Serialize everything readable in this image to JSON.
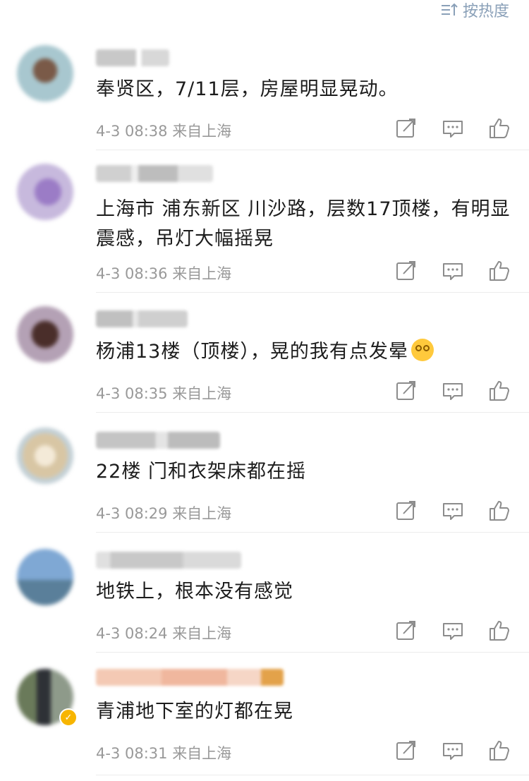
{
  "sort": {
    "label": "按热度",
    "icon": "sort-icon"
  },
  "comments": [
    {
      "text": "奉贤区，7/11层，房屋明显晃动。",
      "time": "4-3 08:38",
      "location": "来自上海"
    },
    {
      "text": "上海市 浦东新区 川沙路，层数17顶楼，有明显震感，吊灯大幅摇晃",
      "time": "4-3 08:36",
      "location": "来自上海"
    },
    {
      "text": "杨浦13楼（顶楼），晃的我有点发晕",
      "emoji": "dizzy-face-emoji",
      "time": "4-3 08:35",
      "location": "来自上海"
    },
    {
      "text": "22楼 门和衣架床都在摇",
      "time": "4-3 08:29",
      "location": "来自上海"
    },
    {
      "text": "地铁上，根本没有感觉",
      "time": "4-3 08:24",
      "location": "来自上海"
    },
    {
      "text": "青浦地下室的灯都在晃",
      "time": "4-3 08:31",
      "location": "来自上海",
      "verified_badge": "verified-badge-icon"
    }
  ],
  "actions": [
    "share-icon",
    "reply-icon",
    "like-icon"
  ],
  "colors": {
    "meta": "#999999",
    "text": "#1c1c1c",
    "icon": "#8c8c8c",
    "sort": "#8aa0b8"
  }
}
